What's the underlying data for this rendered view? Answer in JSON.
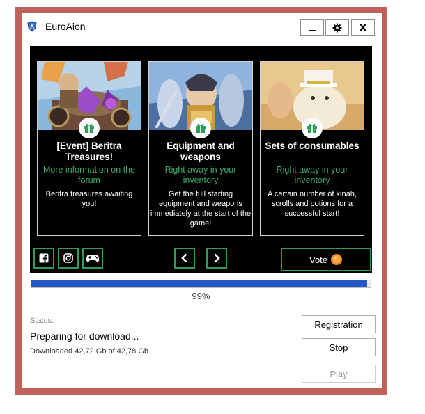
{
  "window": {
    "title": "EuroAion"
  },
  "titlebar": {
    "minimize_glyph": "▁",
    "settings_icon": "gear-icon",
    "close_glyph": "X"
  },
  "cards": [
    {
      "title": "[Event] Beritra Treasures!",
      "link": "More information on the forum",
      "description": "Beritra treasures awaiting you!"
    },
    {
      "title": "Equipment and weapons",
      "link": "Right away in your inventory",
      "description": "Get the full starting equipment and weapons immediately at the start of the game!"
    },
    {
      "title": "Sets of consumables",
      "link": "Right away in your inventory",
      "description": "A certain number of kinah, scrolls and potions for a successful start!"
    }
  ],
  "social": [
    "facebook-icon",
    "instagram-icon",
    "gamepad-icon"
  ],
  "carousel": {
    "prev_glyph": "‹",
    "next_glyph": "›"
  },
  "vote": {
    "label": "Vote"
  },
  "progress": {
    "value": 0.99,
    "text": "99%"
  },
  "status": {
    "label": "Status:",
    "text": "Preparing for download...",
    "downloaded": "Downloaded 42,72 Gb of 42,78 Gb"
  },
  "actions": {
    "registration": "Registration",
    "stop": "Stop",
    "play": "Play"
  },
  "colors": {
    "accent_green": "#2e9d5a",
    "link_green": "#3ca86a",
    "progress_blue": "#2457c5",
    "frame": "#c0625a"
  }
}
